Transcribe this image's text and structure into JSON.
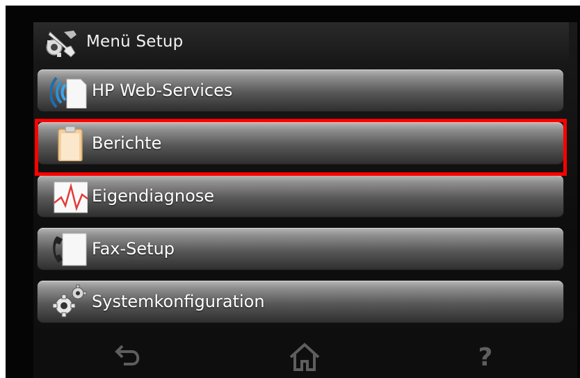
{
  "header": {
    "title": "Menü Setup",
    "icon": "wrench-screwdriver-icon"
  },
  "menu": {
    "items": [
      {
        "label": "HP Web-Services",
        "icon": "hp-web-services-icon"
      },
      {
        "label": "Berichte",
        "icon": "clipboard-report-icon",
        "selected": true
      },
      {
        "label": "Eigendiagnose",
        "icon": "diagnostic-graph-icon"
      },
      {
        "label": "Fax-Setup",
        "icon": "fax-phone-icon"
      },
      {
        "label": "Systemkonfiguration",
        "icon": "gears-icon"
      }
    ]
  },
  "navigation": {
    "back_icon": "back-icon",
    "home_icon": "home-icon",
    "help_glyph": "?"
  },
  "colors": {
    "highlight": "#ff0000",
    "text": "#ffffff",
    "nav_icons": "#5e5e5e"
  }
}
